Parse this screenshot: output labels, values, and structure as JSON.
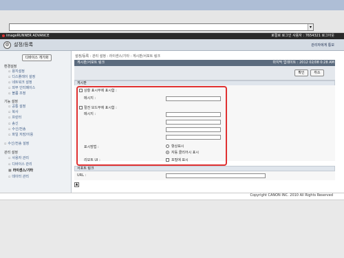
{
  "app": {
    "brand": "imageRUNNER ADVANCE",
    "user_info": "로컬로 로그인 사용자 : 7654321   로그아웃",
    "title": "설정/등록",
    "title_right": "관리자에게 통보"
  },
  "sidebar": {
    "device_button": "디바이스 개기화",
    "sections": [
      {
        "label": "환경설정",
        "items": [
          "용지설정",
          "디스플레이 설정",
          "네트워크 설정",
          "외부 인터페이스",
          "볼륨 조정"
        ]
      },
      {
        "label": "기능 설정",
        "items": [
          "공통 설정",
          "복사",
          "프린터",
          "송신",
          "수신/전송",
          "파일 저장/이용"
        ]
      },
      {
        "label": "",
        "items": [
          "수신/전송 설정"
        ]
      },
      {
        "label": "관리 설정",
        "items": [
          "사용자 관리",
          "디바이스 관리",
          "라이센스/기타",
          "데이터 관리"
        ]
      }
    ]
  },
  "main": {
    "breadcrumb": "설정/등록 : 관리 설정 : 라이센스/기타 : 게시판/서포트 링크",
    "panel_title": "게시판/서포트 링크",
    "panel_time": "마지막 업데이트 : 2012 02/08 0:28 AM",
    "ok_label": "확인",
    "cancel_label": "취소",
    "section_board": "게시판",
    "check_message_label": "상황 표시부에 표시함 :",
    "message_label": "메시지 :",
    "check_screensaver_label": "절전 모드부에 표시함 :",
    "message2_label": "메시지 :",
    "display_method_label": "표시방법 :",
    "radio_always": "항상표시",
    "radio_auto": "자동 클리어시 표시",
    "remote_ui_label": "리모트 UI :",
    "remote_ui_check": "포털에 표시",
    "section_support": "서포트 링크",
    "url_label": "URL :"
  },
  "footer": {
    "copyright": "Copyright CANON INC. 2010 All Rights Reserved"
  }
}
